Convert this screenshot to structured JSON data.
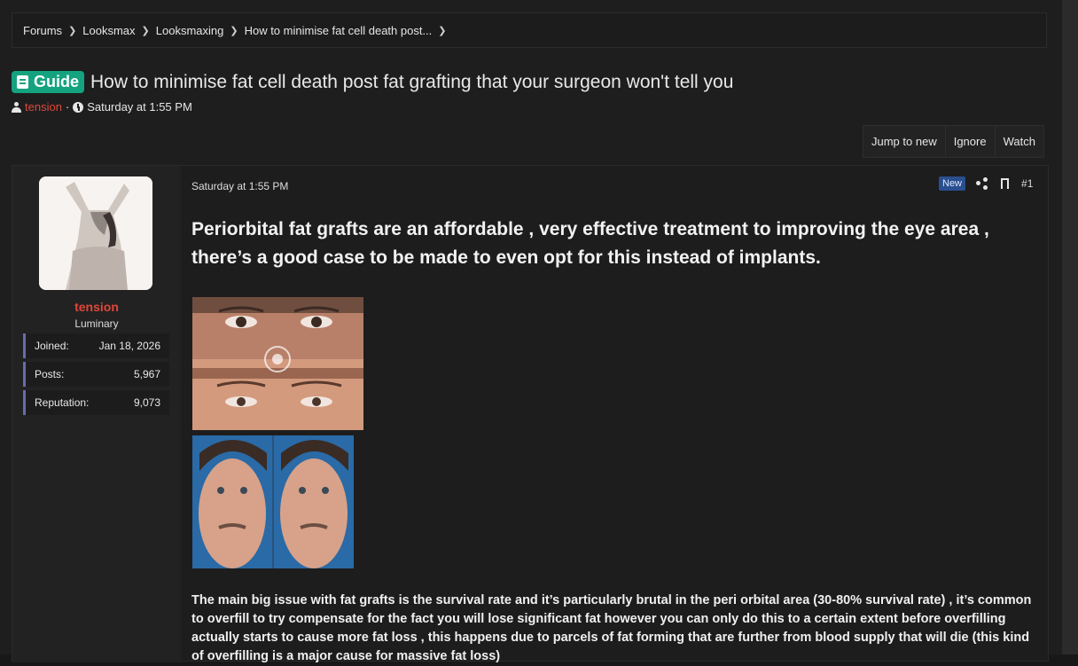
{
  "breadcrumb": [
    "Forums",
    "Looksmax",
    "Looksmaxing",
    "How to minimise fat cell death post..."
  ],
  "thread": {
    "prefix": "Guide",
    "title": "How to minimise fat cell death post fat grafting that your surgeon won't tell you",
    "author": "tension",
    "date": "Saturday at 1:55 PM"
  },
  "actions": [
    "Jump to new",
    "Ignore",
    "Watch"
  ],
  "user": {
    "name": "tension",
    "title": "Luminary",
    "stats": [
      {
        "label": "Joined:",
        "value": "Jan 18, 2026"
      },
      {
        "label": "Posts:",
        "value": "5,967"
      },
      {
        "label": "Reputation:",
        "value": "9,073"
      }
    ]
  },
  "post": {
    "date": "Saturday at 1:55 PM",
    "badge": "New",
    "number": "#1",
    "lead": "Periorbital fat grafts are an affordable , very effective treatment to improving the eye area , there’s a good case to be made to even opt for this instead of implants.",
    "body": "The main big issue with fat grafts is the survival rate and it’s particularly brutal in the peri orbital area (30-80% survival rate) , it’s common to overfill to try compensate for the fact you will lose significant fat however you can only do this to a certain extent before overfilling actually starts to cause more fat loss , this happens due to parcels of fat forming that are further from blood supply that will die (this kind of overfilling is a major cause for massive fat loss)"
  },
  "colors": {
    "accent": "#14a37f",
    "username": "#e0463a",
    "new_badge": "#2a4f8f"
  },
  "icons": [
    "chevron-right-icon",
    "book-icon",
    "user-icon",
    "clock-icon",
    "share-icon",
    "bookmark-icon"
  ]
}
